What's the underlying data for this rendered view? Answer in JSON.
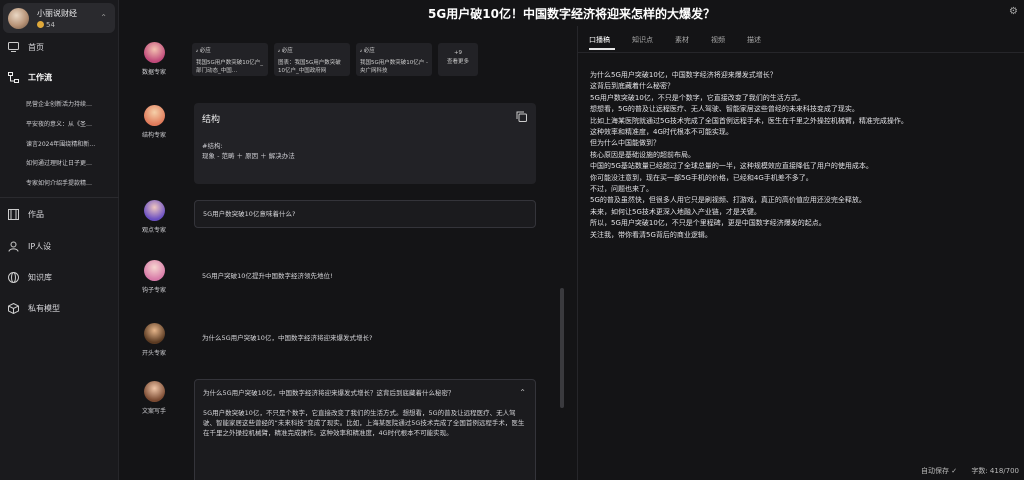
{
  "user": {
    "name": "小丽说财经",
    "coins": "54"
  },
  "nav": {
    "home": "首页",
    "workflow": "工作流",
    "works": "作品",
    "ip_persona": "IP人设",
    "knowledge": "知识库",
    "private_model": "私有模型"
  },
  "workflow_items": [
    "民营企业创新活力持续…",
    "平安夜的意义：从《圣…",
    "谏言2024年围绕精和新…",
    "如何通过理财让日子更…",
    "专家如何介绍手提款精…"
  ],
  "title": "5G用户破10亿！中国数字经济将迎来怎样的大爆发？",
  "experts": {
    "data": "数据专家",
    "structure": "结构专家",
    "viewpoint": "观点专家",
    "hook": "钩子专家",
    "opening": "开头专家",
    "copywriter": "文案写手"
  },
  "data_cards": [
    {
      "tag": "必应",
      "text": "我国5G用户数突破10亿户_部门动态_中国…"
    },
    {
      "tag": "必应",
      "text": "图表：我国5G用户数突破10亿户_中国政府网"
    },
    {
      "tag": "必应",
      "text": "我国5G用户数突破10亿户 - 央广网科技"
    }
  ],
  "more_count": "+9",
  "more_label": "查看更多",
  "structure": {
    "title": "结构",
    "label": "#结构:",
    "body": "现象 - 范畴 ＋ 原因 ＋ 解决办法"
  },
  "viewpoint_text": "5G用户数突破10亿意味着什么?",
  "hook_text": "5G用户突破10亿提升中国数字经济领先地位!",
  "opening_text": "为什么5G用户突破10亿，中国数字经济将迎来爆发式增长?",
  "copy_text": {
    "line1": "为什么5G用户突破10亿，中国数字经济将迎来爆发式增长？这背后到底藏着什么秘密？",
    "para": "5G用户数突破10亿，不只是个数字，它直接改变了我们的生活方式。想想看，5G的普及让远程医疗、无人驾驶、智能家居这些曾经的“未来科技”变成了现实。比如，上海某医院通过5G技术完成了全国首例远程手术，医生在千里之外操控机械臂，精准完成操作。这种效率和精准度，4G时代根本不可能实现。"
  },
  "tabs": [
    "口播稿",
    "知识点",
    "素材",
    "视频",
    "描述"
  ],
  "editor_lines": [
    "为什么5G用户突破10亿，中国数字经济将迎来爆发式增长？",
    "这背后到底藏着什么秘密？",
    "5G用户数突破10亿，不只是个数字，它直接改变了我们的生活方式。",
    "想想看，5G的普及让远程医疗、无人驾驶、智能家居这些曾经的未来科技变成了现实。",
    "比如上海某医院就通过5G技术完成了全国首例远程手术，医生在千里之外操控机械臂，精准完成操作。",
    "这种效率和精准度，4G时代根本不可能实现。",
    "但为什么中国能做到？",
    "核心原因是基础设施的超前布局。",
    "中国的5G基站数量已经超过了全球总量的一半，这种规模效应直接降低了用户的使用成本。",
    "你可能没注意到，现在买一部5G手机的价格，已经和4G手机差不多了。",
    "不过，问题也来了。",
    "5G的普及虽然快，但很多人用它只是刷视频、打游戏，真正的高价值应用还没完全释放。",
    "未来，如何让5G技术更深入地融入产业链，才是关键。",
    "所以，5G用户突破10亿，不只是个里程碑，更是中国数字经济爆发的起点。",
    "关注我，带你看清5G背后的商业逻辑。"
  ],
  "status": {
    "autosave": "自动保存 ✓",
    "wordcount": "字数: 418/700"
  }
}
